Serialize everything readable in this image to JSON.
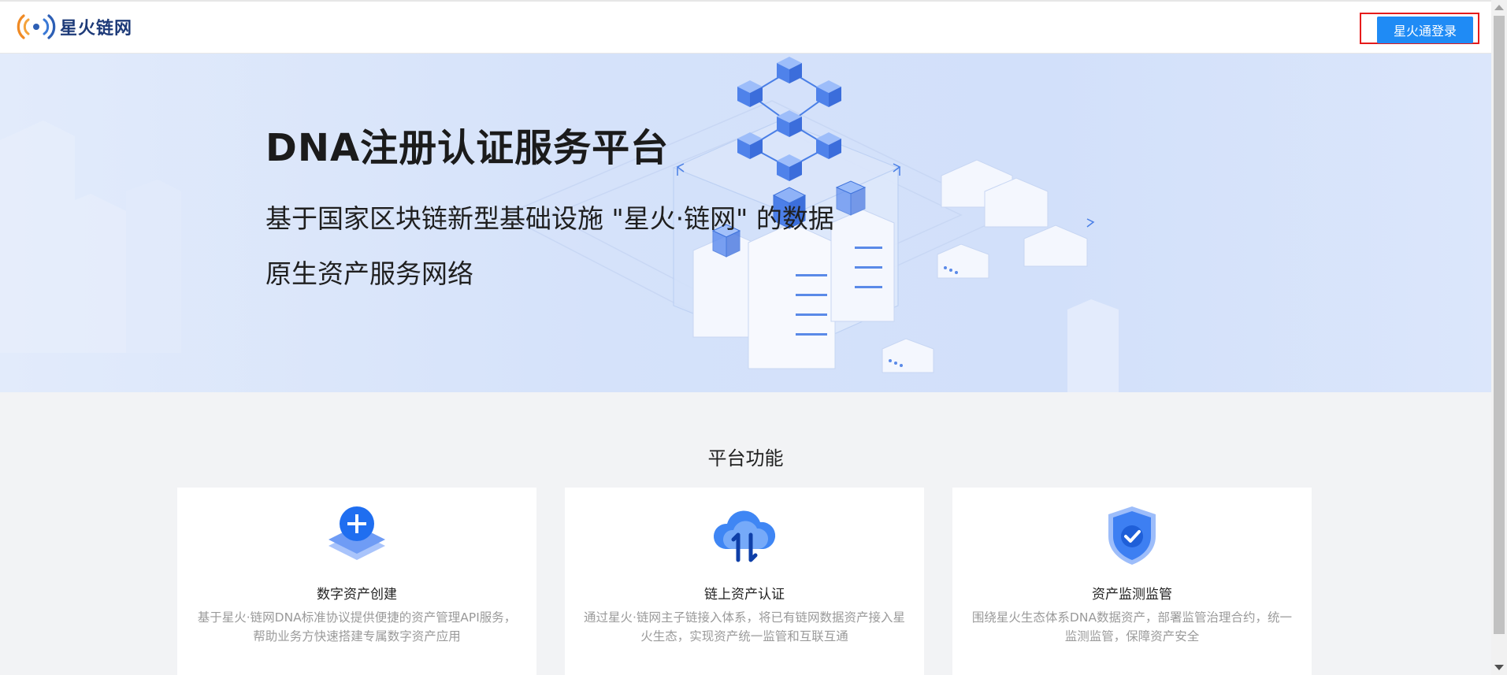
{
  "header": {
    "logo_text": "星火链网",
    "login_label": "星火通登录"
  },
  "hero": {
    "title": "DNA注册认证服务平台",
    "subtitle_line1": "基于国家区块链新型基础设施 \"星火·链网\" 的数据",
    "subtitle_line2": "原生资产服务网络"
  },
  "features": {
    "section_title": "平台功能",
    "cards": [
      {
        "icon": "add-layers-icon",
        "title": "数字资产创建",
        "desc": "基于星火·链网DNA标准协议提供便捷的资产管理API服务，帮助业务方快速搭建专属数字资产应用"
      },
      {
        "icon": "cloud-sync-icon",
        "title": "链上资产认证",
        "desc": "通过星火·链网主子链接入体系，将已有链网数据资产接入星火生态，实现资产统一监管和互联互通"
      },
      {
        "icon": "shield-check-icon",
        "title": "资产监测监管",
        "desc": "围绕星火生态体系DNA数据资产，部署监管治理合约，统一监测监管，保障资产安全"
      }
    ]
  },
  "colors": {
    "primary": "#1f8bf5",
    "brand_text": "#1d3a78",
    "highlight_border": "#e61b1b"
  }
}
